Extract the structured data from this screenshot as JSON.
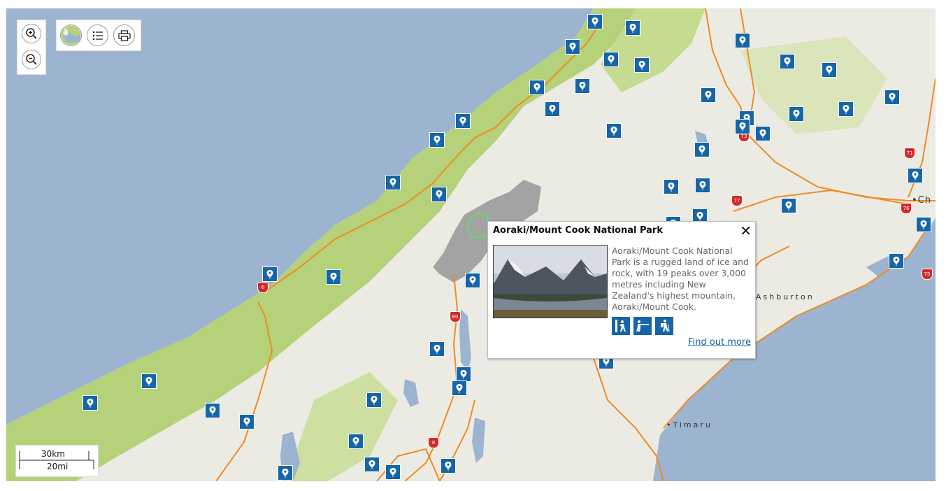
{
  "controls": {
    "zoom_in_icon": "zoom-in-icon",
    "zoom_out_icon": "zoom-out-icon",
    "basemap_icon": "globe-icon",
    "list_icon": "list-icon",
    "print_icon": "printer-icon"
  },
  "labels": {
    "timaru": "Timaru",
    "ashburton": "Ashburton",
    "christchurch_partial": "Ch"
  },
  "route_shields": [
    "6",
    "80",
    "8",
    "73",
    "77",
    "71",
    "76",
    "75"
  ],
  "popup": {
    "title": "Aoraki/Mount Cook National Park",
    "close": "✕",
    "description": "Aoraki/Mount Cook National Park is a rugged land of ice and rock, with 19 peaks over 3,000 metres including New Zealand's highest mountain, Aoraki/Mount Cook.",
    "activities": [
      "climbing-icon",
      "hunting-icon",
      "hiking-icon"
    ],
    "link": "Find out more"
  },
  "scale": {
    "metric": "30km",
    "imperial": "20mi"
  },
  "colors": {
    "poi": "#1565a8",
    "water": "#9cb4cf",
    "land": "#ecebe3",
    "forest": "#b5d17a",
    "road": "#f08a24",
    "highway_shield": "#d42a2a"
  }
}
